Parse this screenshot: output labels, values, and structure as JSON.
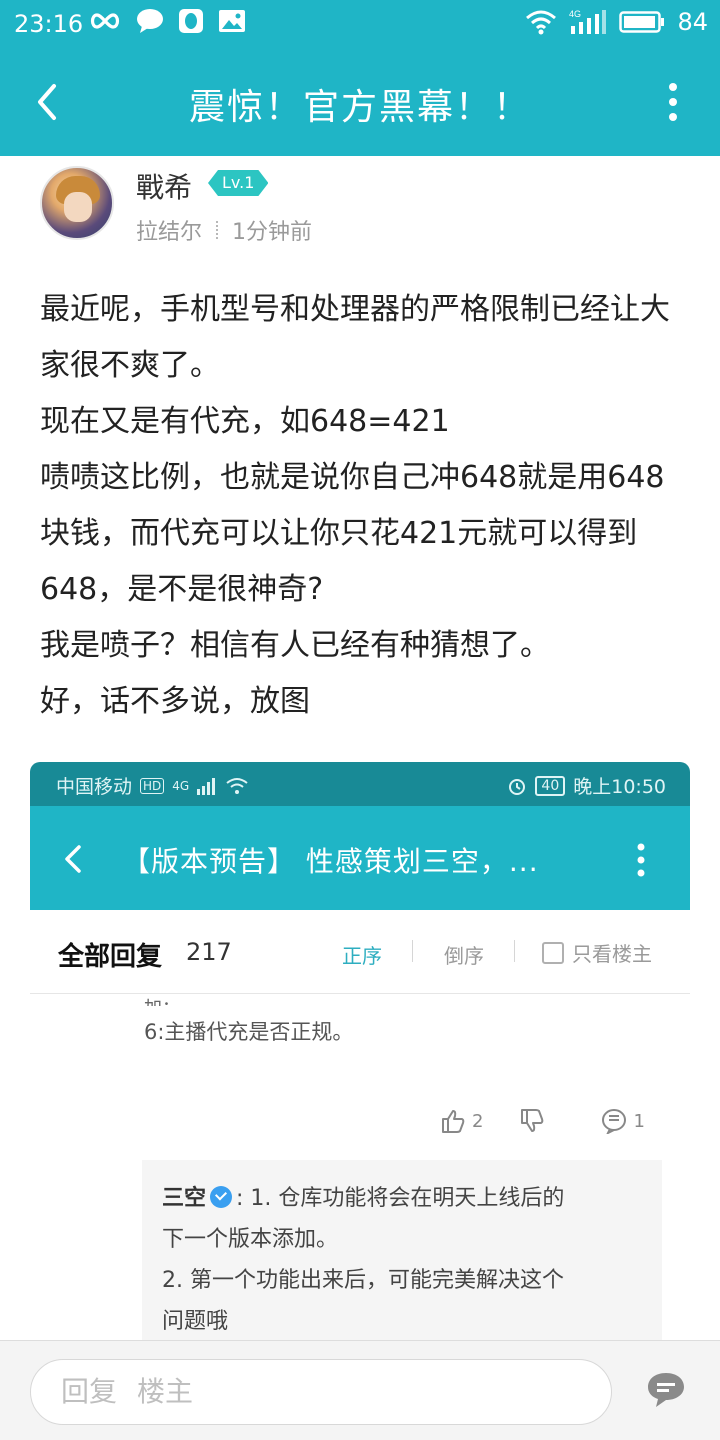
{
  "status_bar": {
    "time": "23:16",
    "network": "4G",
    "battery": "84"
  },
  "header": {
    "title": "震惊！官方黑幕！！"
  },
  "author": {
    "name": "戰希",
    "level": "Lv.1",
    "location": "拉结尔",
    "time": "1分钟前"
  },
  "post": {
    "paragraphs": [
      "最近呢，手机型号和处理器的严格限制已经让大家很不爽了。",
      "现在又是有代充，如648=421",
      "啧啧这比例，也就是说你自己冲648就是用648块钱，而代充可以让你只花421元就可以得到648，是不是很神奇?",
      "我是喷子？相信有人已经有种猜想了。",
      "好，话不多说，放图"
    ]
  },
  "screenshot": {
    "status": {
      "carrier": "中国移动",
      "hd": "HD",
      "net": "4G",
      "battery": "40",
      "time": "晚上10:50"
    },
    "title": "【版本预告】 性感策划三空，...",
    "tabs": {
      "all": "全部回复",
      "count": "217",
      "asc": "正序",
      "desc": "倒序",
      "owner_only": "只看楼主"
    },
    "cut_text": "加：",
    "line6": "6:主播代充是否正规。",
    "actions": {
      "likes": "2",
      "comments": "1"
    },
    "reply": {
      "name": "三空",
      "lines": [
        ": 1. 仓库功能将会在明天上线后的",
        "下一个版本添加。",
        "2. 第一个功能出来后，可能完美解决这个",
        "问题哦"
      ]
    }
  },
  "bottom": {
    "reply_label": "回复",
    "target": "楼主"
  },
  "colors": {
    "accent": "#1fb5c6",
    "level_badge": "#2cc5c2"
  },
  "icons": [
    "back-icon",
    "more-icon",
    "like-icon",
    "dislike-icon",
    "comment-icon"
  ]
}
